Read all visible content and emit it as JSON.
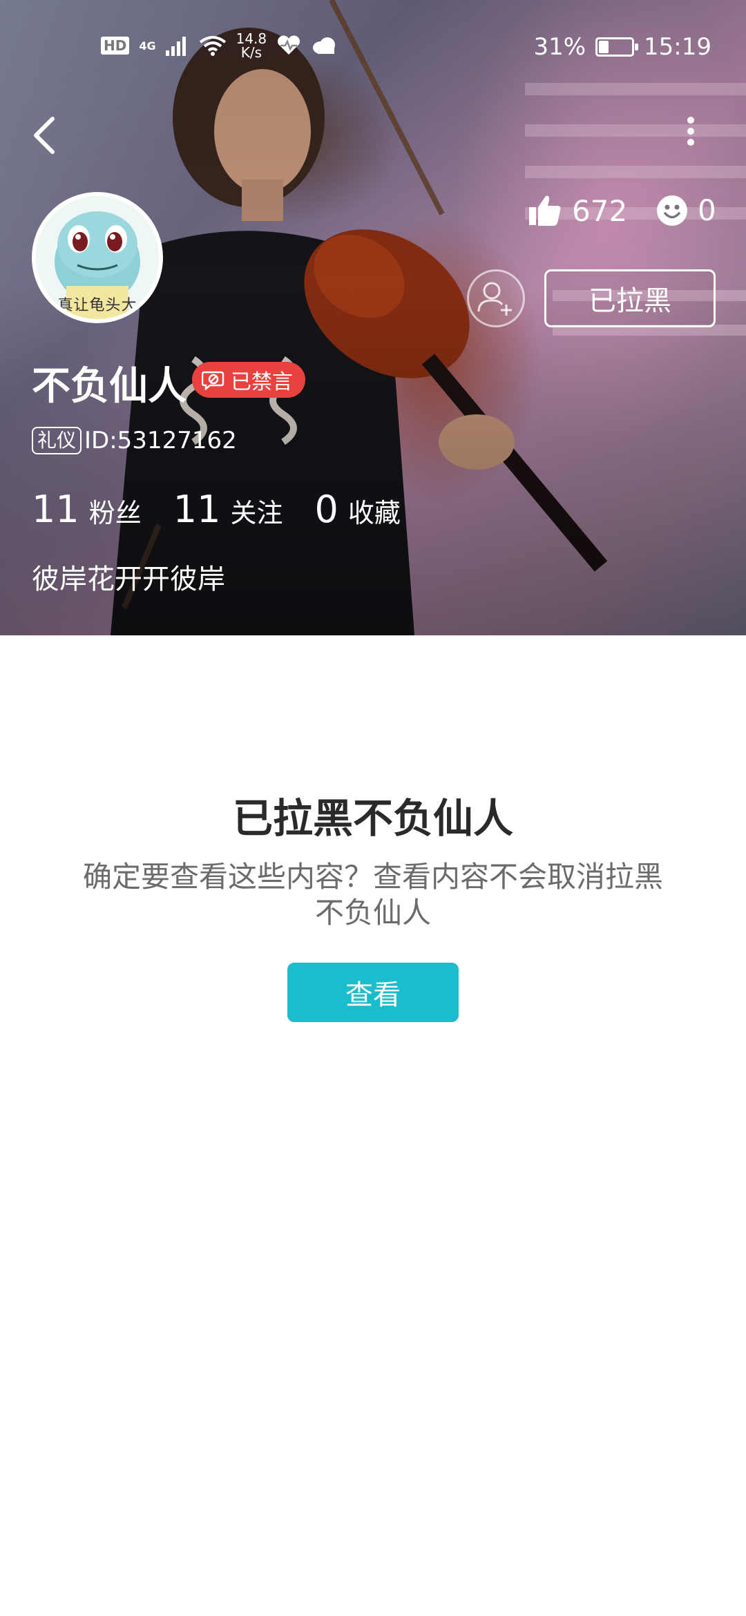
{
  "status_bar": {
    "hd": "HD",
    "network": "4G",
    "speed_value": "14.8",
    "speed_unit": "K/s",
    "battery": "31%",
    "battery_level": 0.31,
    "time": "15:19"
  },
  "header": {
    "likes": "672",
    "smiles": "0",
    "avatar_caption": "真让龟头大",
    "blocked_label": "已拉黑",
    "username": "不负仙人",
    "muted_label": "已禁言",
    "etiquette_tag": "礼仪",
    "user_id": "ID:53127162",
    "fans_count": "11",
    "fans_label": "粉丝",
    "following_count": "11",
    "following_label": "关注",
    "favorites_count": "0",
    "favorites_label": "收藏",
    "bio": "彼岸花开开彼岸"
  },
  "notice": {
    "title": "已拉黑不负仙人",
    "body": "确定要查看这些内容？查看内容不会取消拉黑不负仙人",
    "view_label": "查看"
  },
  "colors": {
    "muted_badge": "#e8413e",
    "view_button": "#1bbccb"
  }
}
